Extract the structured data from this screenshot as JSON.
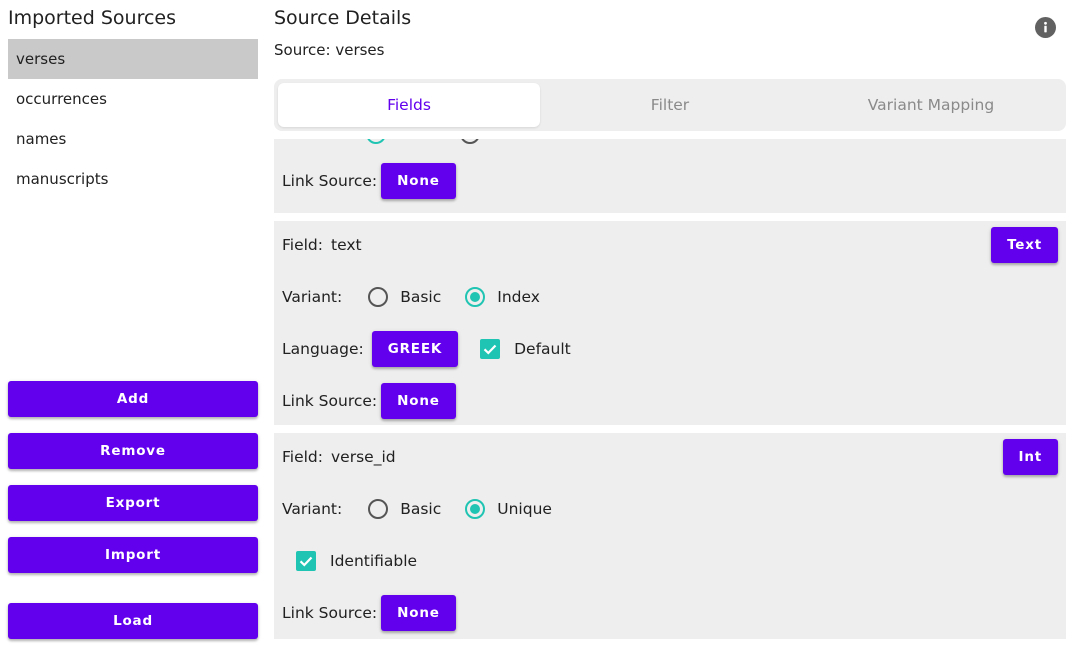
{
  "sidebar": {
    "title": "Imported Sources",
    "sources": [
      "verses",
      "occurrences",
      "names",
      "manuscripts"
    ],
    "selected": "verses",
    "buttons": {
      "add": "Add",
      "remove": "Remove",
      "export": "Export",
      "import": "Import",
      "load": "Load"
    }
  },
  "main": {
    "title": "Source Details",
    "subtitle": "Source: verses",
    "tabs": [
      "Fields",
      "Filter",
      "Variant Mapping"
    ],
    "active_tab": "Fields"
  },
  "labels": {
    "field": "Field:",
    "variant": "Variant:",
    "language": "Language:",
    "link_source": "Link Source:"
  },
  "fields": {
    "partial": {
      "link_source": "None"
    },
    "text": {
      "name": "text",
      "type": "Text",
      "variants": [
        "Basic",
        "Index"
      ],
      "selected_variant": "Index",
      "language": "GREEK",
      "default_label": "Default",
      "default_checked": true,
      "link_source": "None"
    },
    "verse_id": {
      "name": "verse_id",
      "type": "Int",
      "variants": [
        "Basic",
        "Unique"
      ],
      "selected_variant": "Unique",
      "identifiable_label": "Identifiable",
      "identifiable_checked": true,
      "link_source": "None"
    }
  },
  "colors": {
    "accent": "#6200ee",
    "teal": "#20c4b2",
    "card_bg": "#eeeeee",
    "selected_bg": "#c9c9c9"
  },
  "icons": {
    "info": "info-icon",
    "check": "check-icon"
  }
}
